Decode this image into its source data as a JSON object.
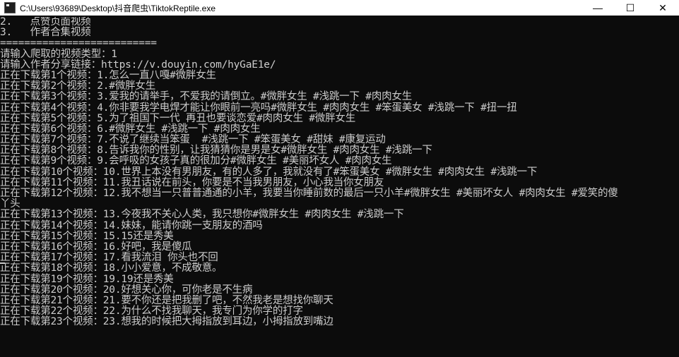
{
  "window": {
    "title": "C:\\Users\\93689\\Desktop\\抖音爬虫\\TiktokReptile.exe",
    "controls": {
      "minimize": "—",
      "maximize": "☐",
      "close": "✕"
    }
  },
  "console": {
    "lines": [
      "2.   点赞页面视频",
      "3.   作者合集视频",
      "==========================",
      "请输入爬取的视频类型：1",
      "请输入作者分享链接：https://v.douyin.com/hyGaE1e/",
      "正在下载第1个视频：1.怎么一直八嘎#微胖女生",
      "正在下载第2个视频：2.#微胖女生",
      "正在下载第3个视频：3.爱我的请举手，不爱我的请倒立。#微胖女生 #浅跳一下 #肉肉女生",
      "正在下载第4个视频：4.你非要我学电焊才能让你眼前一亮吗#微胖女生 #肉肉女生 #笨蛋美女 #浅跳一下 #扭一扭",
      "正在下载第5个视频：5.为了祖国下一代 再丑也要谈恋爱#肉肉女生 #微胖女生",
      "正在下载第6个视频：6.#微胖女生 #浅跳一下 #肉肉女生",
      "正在下载第7个视频：7.不说了继续当笨蛋  #浅跳一下 #笨蛋美女 #甜妹 #康复运动",
      "正在下载第8个视频：8.告诉我你的性别，让我猜猜你是男是女#微胖女生 #肉肉女生 #浅跳一下",
      "正在下载第9个视频：9.会呼吸的女孩子真的很加分#微胖女生 #美丽坏女人 #肉肉女生",
      "正在下载第10个视频：10.世界上本没有男朋友，有的人多了，我就没有了#笨蛋美女 #微胖女生 #肉肉女生 #浅跳一下",
      "正在下载第11个视频：11.我丑话说在前头，你要是不当我男朋友，小心我当你女朋友",
      "正在下载第12个视频：12.我不想当一只普普通通的小羊，我要当你睡前数的最后一只小羊#微胖女生 #美丽坏女人 #肉肉女生 #爱笑的傻",
      "丫头",
      "正在下载第13个视频：13.今夜我不关心人类，我只想你#微胖女生 #肉肉女生 #浅跳一下",
      "正在下载第14个视频：14.妹妹，能请你跳一支朋友的酒吗",
      "正在下载第15个视频：15.15还是秀美",
      "正在下载第16个视频：16.好吧，我是傻瓜",
      "正在下载第17个视频：17.看我流泪 你头也不回",
      "正在下载第18个视频：18.小小爱意，不成敬意。",
      "正在下载第19个视频：19.19还是秀美",
      "正在下载第20个视频：20.好想关心你，可你老是不生病",
      "正在下载第21个视频：21.要不你还是把我删了吧，不然我老是想找你聊天",
      "正在下载第22个视频：22.为什么不找我聊天，我专门为你学的打字",
      "正在下载第23个视频：23.想我的时候把大拇指放到耳边，小拇指放到嘴边"
    ]
  }
}
